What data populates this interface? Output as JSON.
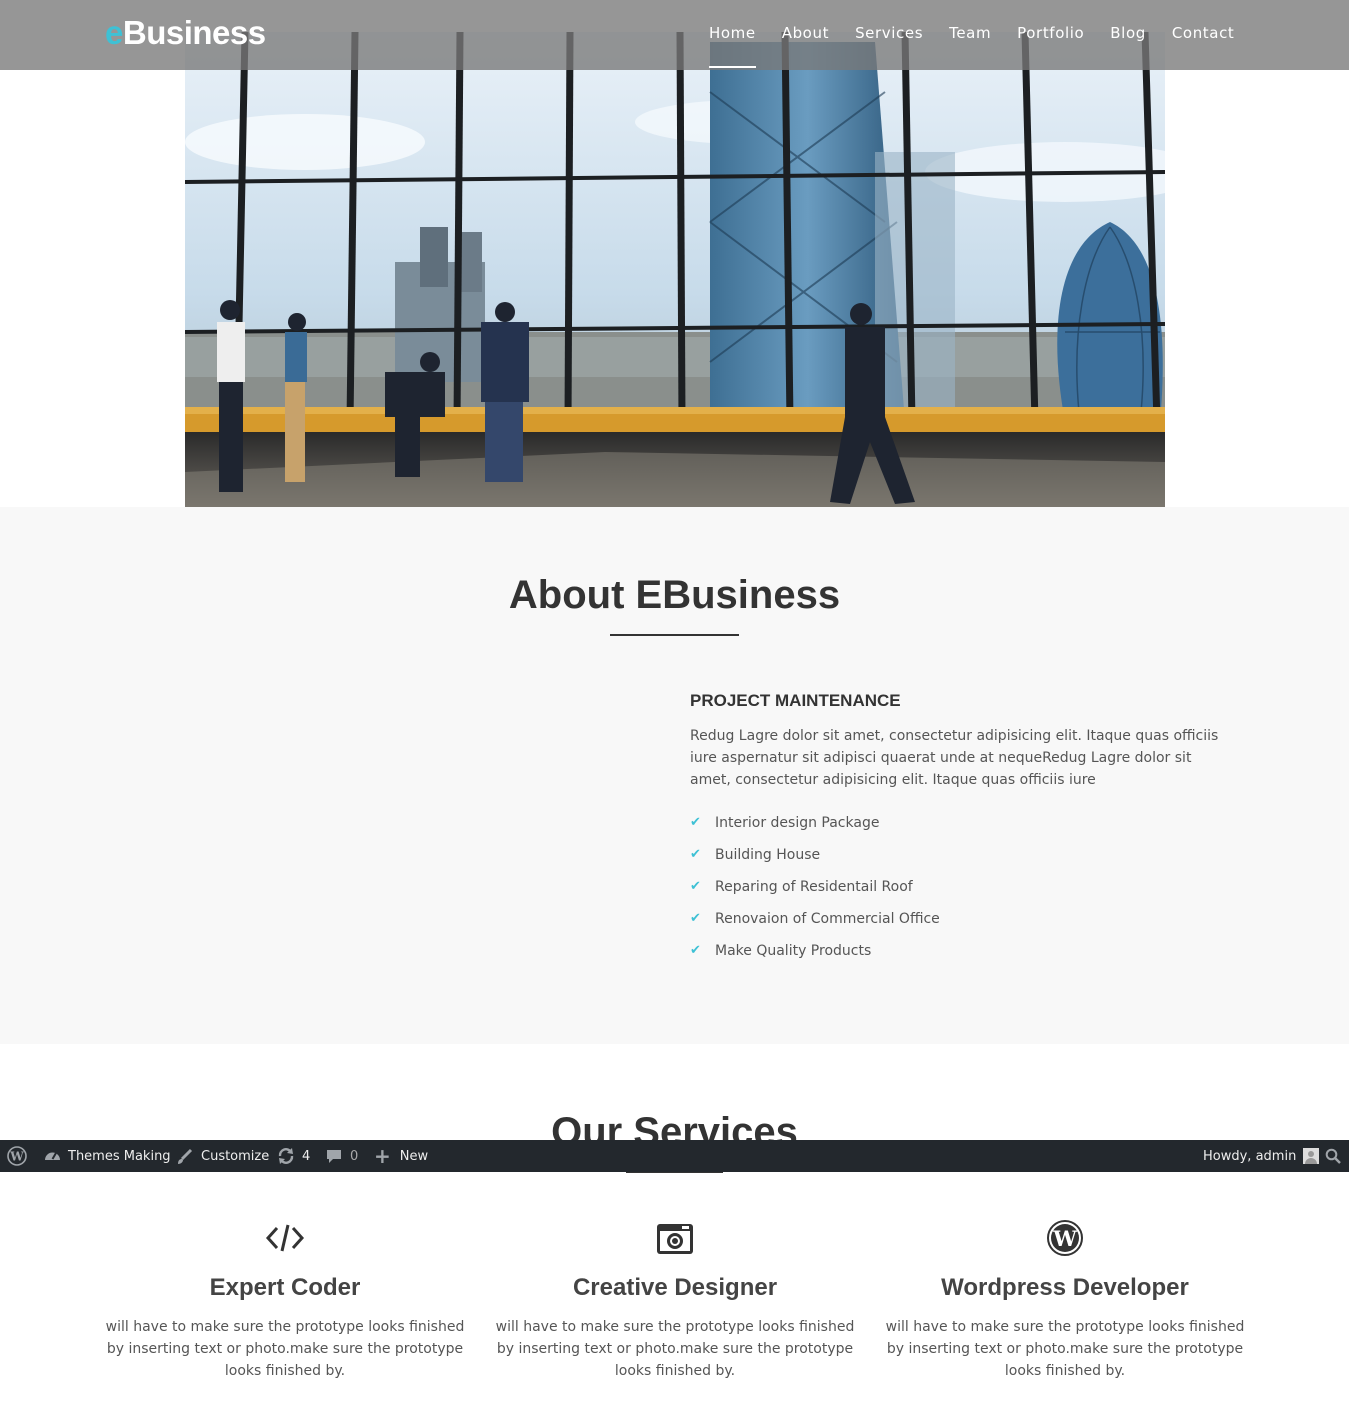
{
  "site": {
    "logo_accent": "e",
    "logo_rest": "Business",
    "accent_color": "#3ec1d5"
  },
  "nav": {
    "items": [
      "Home",
      "About",
      "Services",
      "Team",
      "Portfolio",
      "Blog",
      "Contact"
    ],
    "active": "Home"
  },
  "about": {
    "title": "About EBusiness",
    "heading": "PROJECT MAINTENANCE",
    "text": "Redug Lagre dolor sit amet, consectetur adipisicing elit. Itaque quas officiis iure aspernatur sit adipisci quaerat unde at nequeRedug Lagre dolor sit amet, consectetur adipisicing elit. Itaque quas officiis iure",
    "list": [
      "Interior design Package",
      "Building House",
      "Reparing of Residentail Roof",
      "Renovaion of Commercial Office",
      "Make Quality Products"
    ]
  },
  "services": {
    "title": "Our Services",
    "items": [
      {
        "icon": "code-icon",
        "name": "Expert Coder",
        "text": "will have to make sure the prototype looks finished by inserting text or photo.make sure the prototype looks finished by."
      },
      {
        "icon": "camera-icon",
        "name": "Creative Designer",
        "text": "will have to make sure the prototype looks finished by inserting text or photo.make sure the prototype looks finished by."
      },
      {
        "icon": "wordpress-icon",
        "name": "Wordpress Developer",
        "text": "will have to make sure the prototype looks finished by inserting text or photo.make sure the prototype looks finished by."
      }
    ]
  },
  "adminbar": {
    "site_name": "Themes Making",
    "customize": "Customize",
    "updates": "4",
    "comments": "0",
    "new": "New",
    "howdy": "Howdy, admin"
  }
}
